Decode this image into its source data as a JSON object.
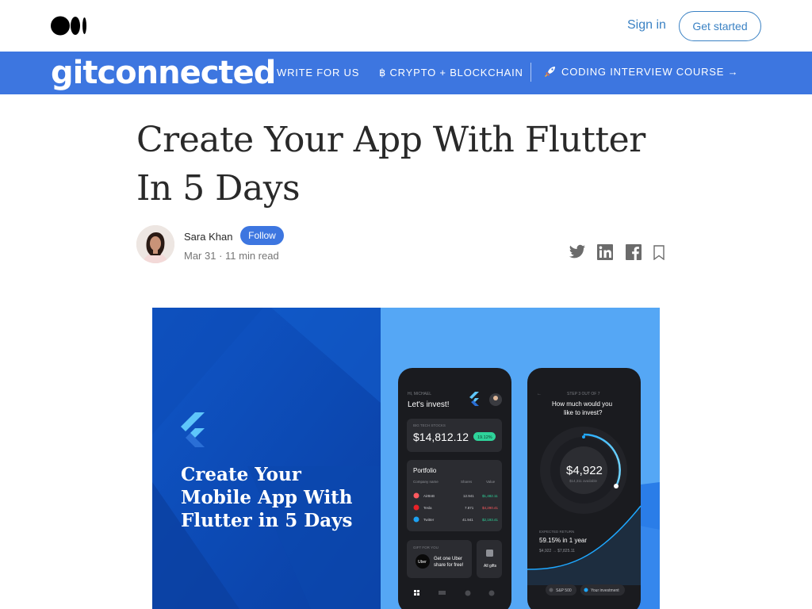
{
  "topbar": {
    "sign_in": "Sign in",
    "get_started": "Get started"
  },
  "publication": {
    "name": "gitconnected",
    "nav": {
      "write": "WRITE FOR US",
      "crypto": "฿ CRYPTO + BLOCKCHAIN",
      "coding": "CODING INTERVIEW COURSE →"
    }
  },
  "article": {
    "title": "Create Your App With Flutter In 5 Days",
    "author": "Sara Khan",
    "follow": "Follow",
    "meta": "Mar 31 · 11 min read"
  },
  "hero": {
    "headline": [
      "Create Your",
      "Mobile App With",
      "Flutter in 5 Days"
    ],
    "phone1": {
      "greeting": "HI, MICHAEL",
      "title": "Let's invest!",
      "stocks_label": "BIG TECH STOCKS",
      "stocks_value": "$14,812.12",
      "stocks_change": "19.12%",
      "portfolio_title": "Portfolio",
      "col_company": "Company name",
      "col_shares": "Shares",
      "col_value": "Value",
      "rows": [
        {
          "name": "AirBnB",
          "shares": "12.941",
          "value": "$1,482.11"
        },
        {
          "name": "Tesla",
          "shares": "7.871",
          "value": "$4,290.41"
        },
        {
          "name": "Twitter",
          "shares": "41.941",
          "value": "$2,193.41"
        }
      ],
      "gift_label": "GIFT FOR YOU",
      "gift_text_1": "Get one Uber",
      "gift_text_2": "share for free!",
      "uber": "Uber",
      "all_gifts": "All gifts"
    },
    "phone2": {
      "step": "STEP 3 OUT OF 7",
      "question_1": "How much would you",
      "question_2": "like to invest?",
      "amount": "$4,922",
      "available": "$14,311 available",
      "expected_label": "EXPECTED RETURN",
      "expected_value": "59.15% in 1 year",
      "expected_range": "$4,922 → $7,825.11",
      "legend_sp": "S&P 500",
      "legend_inv": "Your investment"
    }
  },
  "colors": {
    "brand_blue": "#3d76e0",
    "link_blue": "#3b82c4",
    "follow_blue": "#3d76e0"
  }
}
